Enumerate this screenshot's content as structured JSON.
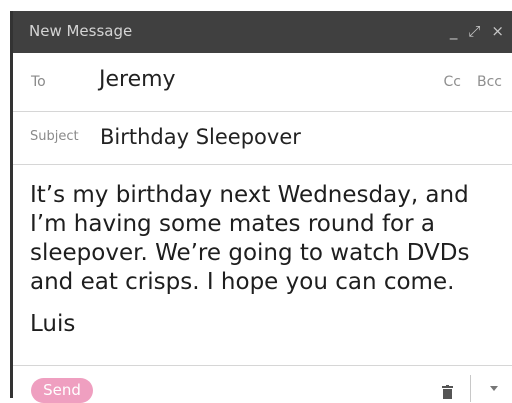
{
  "window": {
    "title": "New Message",
    "controls": {
      "minimize": "_",
      "expand": "⤢",
      "close": "×"
    }
  },
  "to": {
    "label": "To",
    "value": "Jeremy",
    "cc": "Cc",
    "bcc": "Bcc"
  },
  "subject": {
    "label": "Subject",
    "value": "Birthday Sleepover"
  },
  "body": {
    "text": "It’s my birthday next Wednesday, and I’m having some mates round for a sleepover. We’re going to watch DVDs and eat crisps. I hope you can come.",
    "signature": "Luis"
  },
  "footer": {
    "send_label": "Send"
  },
  "colors": {
    "titlebar": "#404040",
    "send_button": "#ef9fc0"
  },
  "icons": [
    "minimize-icon",
    "expand-icon",
    "close-icon",
    "trash-icon",
    "chevron-down-icon"
  ]
}
